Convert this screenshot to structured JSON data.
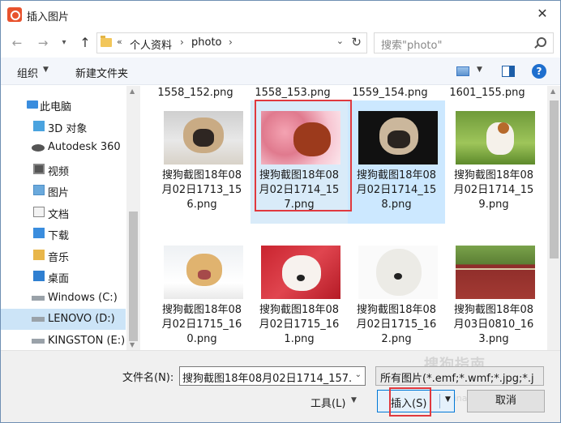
{
  "window": {
    "title": "插入图片"
  },
  "navigation": {
    "breadcrumb": [
      "个人资料",
      "photo"
    ],
    "breadcrumb_overflow": "«",
    "search_placeholder": "搜索\"photo\""
  },
  "toolbar": {
    "organize_label": "组织",
    "new_folder_label": "新建文件夹"
  },
  "sidebar": {
    "items": [
      {
        "label": "此电脑",
        "icon": "computer-icon"
      },
      {
        "label": "3D 对象",
        "icon": "3d-objects-icon"
      },
      {
        "label": "Autodesk 360",
        "icon": "cloud-drive-icon"
      },
      {
        "label": "视频",
        "icon": "video-folder-icon"
      },
      {
        "label": "图片",
        "icon": "pictures-folder-icon"
      },
      {
        "label": "文档",
        "icon": "documents-folder-icon"
      },
      {
        "label": "下载",
        "icon": "downloads-folder-icon"
      },
      {
        "label": "音乐",
        "icon": "music-folder-icon"
      },
      {
        "label": "桌面",
        "icon": "desktop-folder-icon"
      },
      {
        "label": "Windows (C:)",
        "icon": "drive-icon"
      },
      {
        "label": "LENOVO (D:)",
        "icon": "drive-icon"
      },
      {
        "label": "KINGSTON (E:)",
        "icon": "drive-icon"
      }
    ],
    "selected_index": 10
  },
  "files": {
    "top_partial": [
      "1558_152.png",
      "1558_153.png",
      "1559_154.png",
      "1601_155.png"
    ],
    "items": [
      {
        "name": "搜狗截图18年08月02日1713_156.png",
        "thumb": "pug-lying"
      },
      {
        "name": "搜狗截图18年08月02日1714_157.png",
        "thumb": "puppy-flowers"
      },
      {
        "name": "搜狗截图18年08月02日1714_158.png",
        "thumb": "pug-dark"
      },
      {
        "name": "搜狗截图18年08月02日1714_159.png",
        "thumb": "puppy-grass"
      },
      {
        "name": "搜狗截图18年08月02日1715_160.png",
        "thumb": "golden-puppy"
      },
      {
        "name": "搜狗截图18年08月02日1715_161.png",
        "thumb": "white-puppy-red"
      },
      {
        "name": "搜狗截图18年08月02日1715_162.png",
        "thumb": "white-poodle"
      },
      {
        "name": "搜狗截图18年08月03日0810_163.png",
        "thumb": "red-fence"
      }
    ],
    "selected_index": 1,
    "highlighted_index": 2
  },
  "footer": {
    "filename_label": "文件名(N):",
    "filename_value": "搜狗截图18年08月02日1714_157.",
    "filter_value": "所有图片(*.emf;*.wmf;*.jpg;*.jp",
    "tools_label": "工具(L)",
    "insert_label": "插入(S)",
    "cancel_label": "取消",
    "watermark": "搜狗指南",
    "watermark_sub": "zhinan.sogou.com"
  },
  "colors": {
    "accent": "#0078d7",
    "selection": "#cce4f7",
    "annotation_red": "#e0393e",
    "app_icon": "#e8532e"
  }
}
